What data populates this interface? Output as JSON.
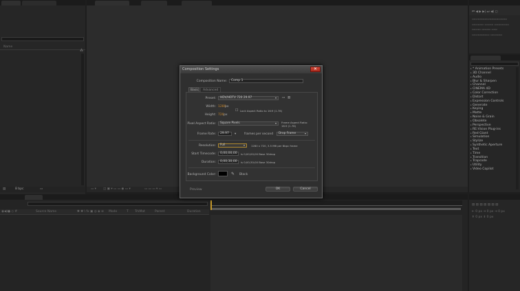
{
  "left_panel": {
    "column_name": "Name",
    "footer_bpc": "8 bpc"
  },
  "effects_panel": {
    "items": [
      "* Animation Presets",
      "3D Channel",
      "Audio",
      "Blur & Sharpen",
      "Channel",
      "CINEMA 4D",
      "Color Correction",
      "Distort",
      "Expression Controls",
      "Generate",
      "Keying",
      "Matte",
      "Noise & Grain",
      "Obsolete",
      "Perspective",
      "RE:Vision Plug-ins",
      "Red Giant",
      "Simulation",
      "Stylize",
      "Synthetic Aperture",
      "Text",
      "Time",
      "Transition",
      "Trapcode",
      "Utility",
      "Video Copilot"
    ]
  },
  "timeline": {
    "headers": [
      "Source Name",
      "Mode",
      "T",
      "TrkMat",
      "Parent",
      "Duration"
    ]
  },
  "dialog": {
    "title": "Composition Settings",
    "close_glyph": "✕",
    "comp_name_label": "Composition Name:",
    "comp_name_value": "Comp 1",
    "tabs": [
      "Basic",
      "Advanced"
    ],
    "preset_label": "Preset:",
    "preset_value": "HDV/HDTV 720 29.97",
    "width_label": "Width:",
    "width_value": "1280",
    "width_unit": "px",
    "height_label": "Height:",
    "height_value": "720",
    "height_unit": "px",
    "lock_aspect_label": "Lock Aspect Ratio to 16:9 (1.78)",
    "par_label": "Pixel Aspect Ratio:",
    "par_value": "Square Pixels",
    "frame_aspect_label": "Frame Aspect Ratio:",
    "frame_aspect_value": "16:9 (1.78)",
    "frame_rate_label": "Frame Rate:",
    "frame_rate_value": "29.97",
    "frame_rate_unit": "frames per second",
    "drop_frame_value": "Drop Frame",
    "resolution_label": "Resolution:",
    "resolution_value": "Full",
    "resolution_info": "1280 x 720, 3.5 MB per 8bpc frame",
    "start_tc_label": "Start Timecode:",
    "start_tc_value": "0;00;00;00",
    "start_tc_info": "is 0;00;00;00  Base 30drop",
    "duration_label": "Duration:",
    "duration_value": "0;00;30;00",
    "duration_info": "is 0;00;30;00  Base 30drop",
    "bg_label": "Background Color:",
    "bg_color_name": "Black",
    "bg_color": "#000000",
    "preview_label": "Preview",
    "ok_label": "OK",
    "cancel_label": "Cancel"
  }
}
